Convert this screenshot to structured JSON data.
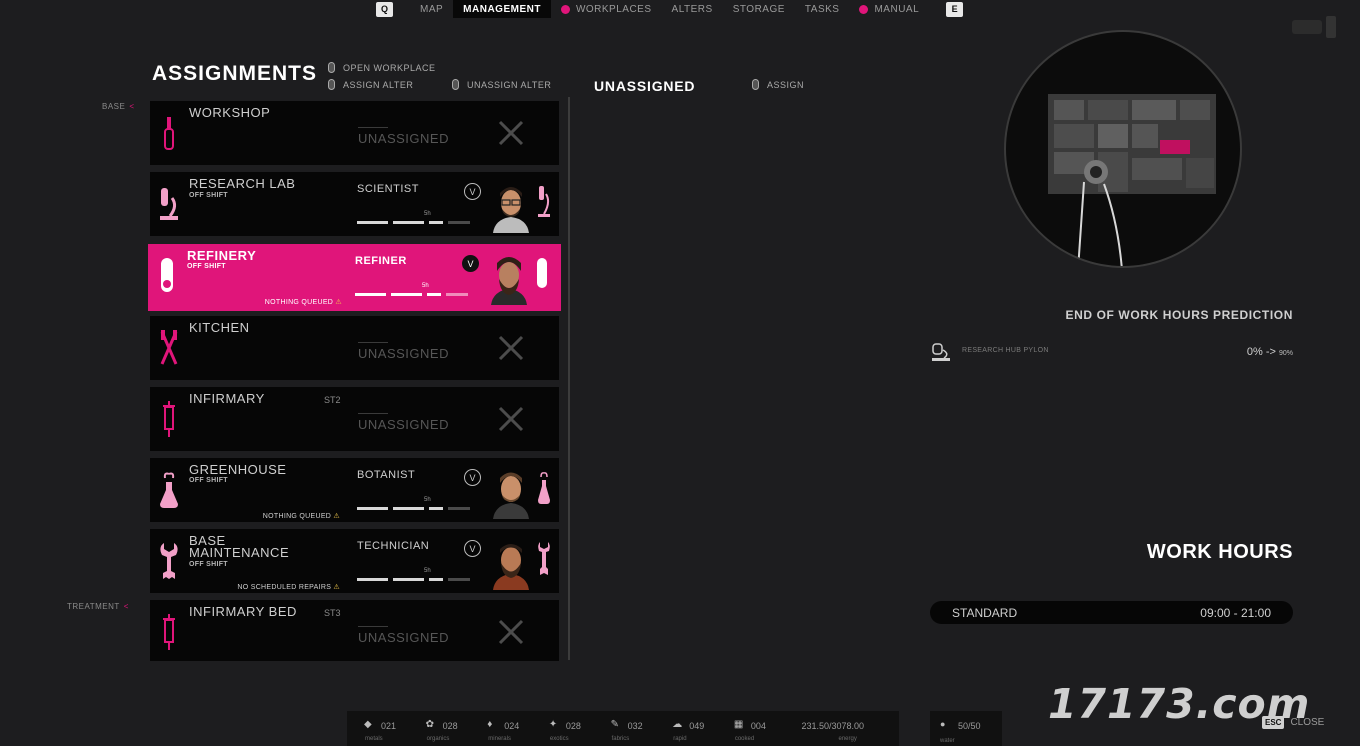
{
  "nav": {
    "key_left": "Q",
    "key_right": "E",
    "items": [
      "MAP",
      "MANAGEMENT",
      "WORKPLACES",
      "ALTERS",
      "STORAGE",
      "TASKS",
      "MANUAL"
    ],
    "active": "MANAGEMENT",
    "dotted": [
      "WORKPLACES",
      "MANUAL"
    ]
  },
  "assignments": {
    "title": "ASSIGNMENTS",
    "hint_open": "OPEN WORKPLACE",
    "hint_assign": "ASSIGN ALTER",
    "hint_unassign": "UNASSIGN ALTER"
  },
  "unassigned_panel": {
    "title": "UNASSIGNED",
    "hint_assign": "ASSIGN"
  },
  "categories": {
    "base": "BASE",
    "treatment": "TREATMENT"
  },
  "workplaces": [
    {
      "name": "WORKSHOP",
      "status": "UNASSIGNED"
    },
    {
      "name": "RESEARCH LAB",
      "shift": "OFF SHIFT",
      "role": "SCIENTIST",
      "badge": "V",
      "hours": "5h"
    },
    {
      "name": "REFINERY",
      "shift": "OFF SHIFT",
      "role": "REFINER",
      "badge": "V",
      "hours": "5h",
      "queue": "NOTHING QUEUED",
      "selected": true
    },
    {
      "name": "KITCHEN",
      "status": "UNASSIGNED"
    },
    {
      "name": "INFIRMARY",
      "code": "ST2",
      "status": "UNASSIGNED"
    },
    {
      "name": "GREENHOUSE",
      "shift": "OFF SHIFT",
      "role": "BOTANIST",
      "badge": "V",
      "hours": "5h",
      "queue": "NOTHING QUEUED"
    },
    {
      "name": "BASE MAINTENANCE",
      "shift": "OFF SHIFT",
      "role": "TECHNICIAN",
      "badge": "V",
      "hours": "5h",
      "queue": "NO SCHEDULED REPAIRS"
    },
    {
      "name": "INFIRMARY BED",
      "code": "ST3",
      "status": "UNASSIGNED"
    }
  ],
  "warn_glyph": "⚠",
  "prediction": {
    "title": "END OF WORK HOURS PREDICTION",
    "item": "RESEARCH HUB PYLON",
    "value": "0% ->",
    "target": "90%"
  },
  "work_hours": {
    "title": "WORK HOURS",
    "mode": "STANDARD",
    "range": "09:00 - 21:00"
  },
  "resources": [
    {
      "icon": "metals-icon",
      "glyph": "◆",
      "value": "021",
      "label": "metals"
    },
    {
      "icon": "organics-icon",
      "glyph": "✿",
      "value": "028",
      "label": "organics"
    },
    {
      "icon": "minerals-icon",
      "glyph": "♦",
      "value": "024",
      "label": "minerals"
    },
    {
      "icon": "exotic-icon",
      "glyph": "✦",
      "value": "028",
      "label": "exotics"
    },
    {
      "icon": "pencil-icon",
      "glyph": "✎",
      "value": "032",
      "label": "fabrics"
    },
    {
      "icon": "cloud-icon",
      "glyph": "☁",
      "value": "049",
      "label": "rapid"
    },
    {
      "icon": "food-icon",
      "glyph": "▦",
      "value": "004",
      "label": "cooked"
    },
    {
      "icon": "energy-icon",
      "glyph": "",
      "value": "231.50/3078.00",
      "label": "energy"
    }
  ],
  "water": {
    "glyph": "●",
    "value": "50/50",
    "label": "water"
  },
  "esc": {
    "key": "ESC",
    "label": "CLOSE"
  },
  "watermark": "17173.com",
  "colors": {
    "accent": "#e0157a",
    "background": "#1d1d1f",
    "card": "#060606"
  }
}
